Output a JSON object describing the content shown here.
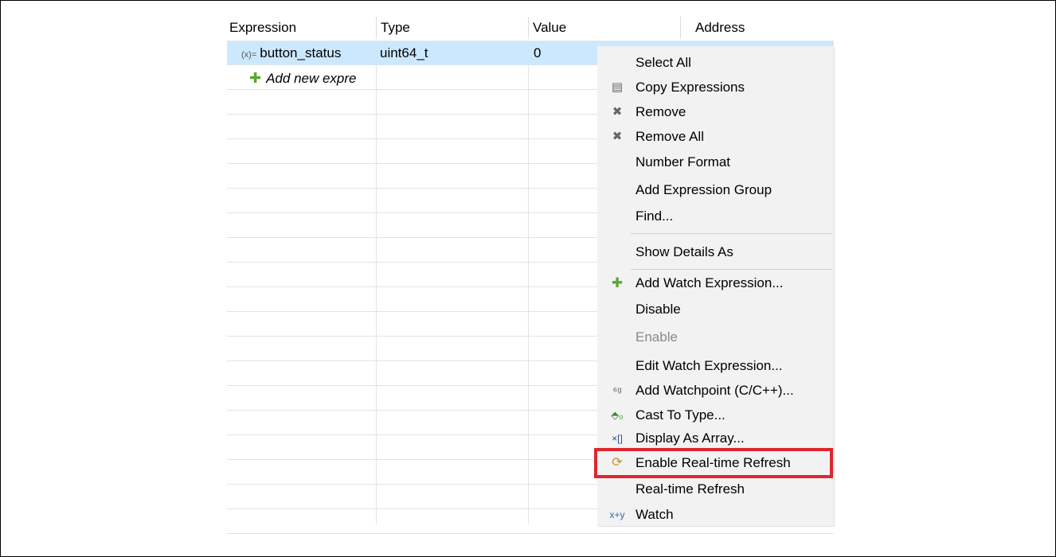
{
  "columns": [
    "Expression",
    "Type",
    "Value",
    "Address"
  ],
  "rows": [
    {
      "expression": "button_status",
      "type": "uint64_t",
      "value": "0",
      "address": ""
    }
  ],
  "add_new_label": "Add new expre",
  "menu": {
    "items": [
      {
        "label": "Select All",
        "icon": ""
      },
      {
        "label": "Copy Expressions",
        "icon": "copy-icon"
      },
      {
        "label": "Remove",
        "icon": "remove-icon"
      },
      {
        "label": "Remove All",
        "icon": "remove-all-icon"
      },
      {
        "label": "Number Format",
        "icon": ""
      },
      {
        "label": "Add Expression Group",
        "icon": ""
      },
      {
        "label": "Find...",
        "icon": ""
      },
      {
        "label": "Show Details As",
        "icon": ""
      },
      {
        "label": "Add Watch Expression...",
        "icon": "add-icon"
      },
      {
        "label": "Disable",
        "icon": ""
      },
      {
        "label": "Enable",
        "icon": "",
        "disabled": true
      },
      {
        "label": "Edit Watch Expression...",
        "icon": ""
      },
      {
        "label": "Add Watchpoint (C/C++)...",
        "icon": "watchpoint-icon"
      },
      {
        "label": "Cast To Type...",
        "icon": "cast-icon"
      },
      {
        "label": "Display As Array...",
        "icon": "array-icon"
      },
      {
        "label": "Enable Real-time Refresh",
        "icon": "refresh-icon"
      },
      {
        "label": "Real-time Refresh",
        "icon": ""
      },
      {
        "label": "Watch",
        "icon": "watch-icon"
      }
    ]
  },
  "colors": {
    "selected_row": "#cce8ff",
    "highlight_box": "#e0252e",
    "menu_bg": "#f2f2f2"
  }
}
